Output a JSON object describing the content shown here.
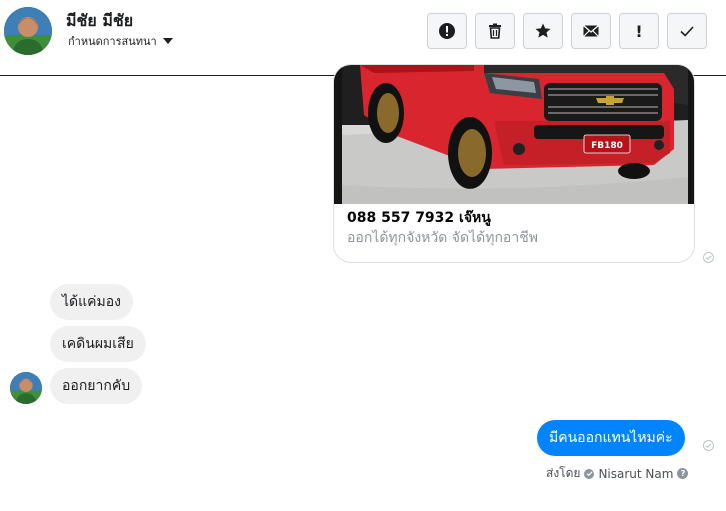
{
  "header": {
    "contact_name": "มีชัย มีชัย",
    "settings_label": "กำหนดการสนทนา",
    "actions": [
      {
        "name": "report-button",
        "icon": "alert-circle-icon"
      },
      {
        "name": "delete-button",
        "icon": "trash-icon"
      },
      {
        "name": "star-button",
        "icon": "star-icon"
      },
      {
        "name": "mark-unread-button",
        "icon": "envelope-icon"
      },
      {
        "name": "spam-button",
        "icon": "exclamation-icon",
        "glyph": "!"
      },
      {
        "name": "done-button",
        "icon": "checkmark-icon"
      }
    ]
  },
  "card": {
    "title": "088 557 7932 เจ๊หนู",
    "subtitle": "ออกได้ทุกจังหวัด จัดได้ทุกอาชีพ",
    "plate": "FB180"
  },
  "incoming": [
    "ได้แค่มอง",
    "เคดินผมเสีย",
    "ออกยากคับ"
  ],
  "outgoing": {
    "text": "มีคนออกแทนไหมค่ะ",
    "sent_by_label": "ส่งโดย",
    "sender": "Nisarut Nam",
    "help_glyph": "?"
  },
  "colors": {
    "outgoing_bubble": "#0084ff",
    "incoming_bubble": "#f1f0f0",
    "car_red": "#d9262e"
  }
}
